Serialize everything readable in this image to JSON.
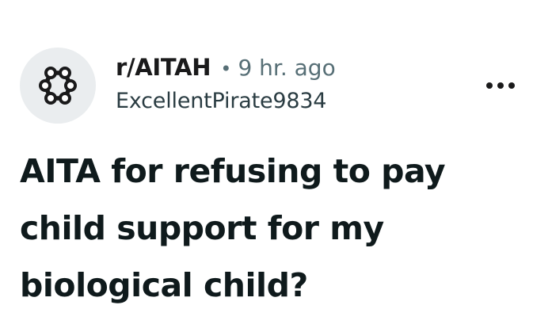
{
  "post": {
    "subreddit": "r/AITAH",
    "separator": "•",
    "time_ago": "9 hr. ago",
    "author": "ExcellentPirate9834",
    "title": "AITA for refusing to pay child support for my biological child?"
  },
  "icons": {
    "avatar": "subreddit-ring-icon",
    "menu": "more-options-icon"
  },
  "colors": {
    "avatar_bg": "#eaedef",
    "text_primary": "#1a1a1b",
    "text_secondary": "#576f76"
  }
}
